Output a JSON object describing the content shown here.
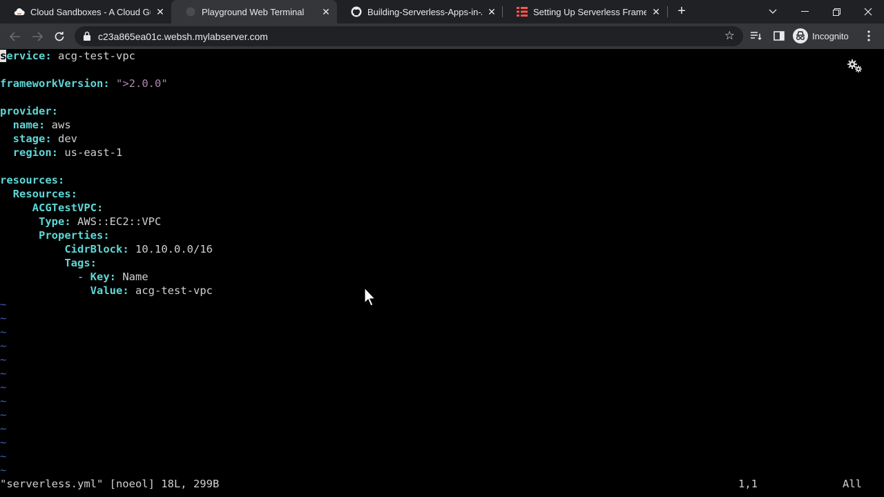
{
  "browser": {
    "tabs": [
      {
        "title": "Cloud Sandboxes - A Cloud Guru",
        "icon": "cloud-icon"
      },
      {
        "title": "Playground Web Terminal",
        "icon": "terminal-icon"
      },
      {
        "title": "Building-Serverless-Apps-in-AWS",
        "icon": "github-icon"
      },
      {
        "title": "Setting Up Serverless Framework",
        "icon": "serverless-icon"
      }
    ],
    "active_tab": 1,
    "url": "c23a865ea01c.websh.mylabserver.com",
    "profile_label": "Incognito"
  },
  "terminal": {
    "lines": [
      {
        "indent": "",
        "key": "service",
        "value": " acg-test-vpc"
      },
      {
        "indent": "",
        "key": "",
        "value": ""
      },
      {
        "indent": "",
        "key": "frameworkVersion",
        "string": "\">2.0.0\""
      },
      {
        "indent": "",
        "key": "",
        "value": ""
      },
      {
        "indent": "",
        "key": "provider",
        "value": ""
      },
      {
        "indent": "  ",
        "key": "name",
        "value": " aws"
      },
      {
        "indent": "  ",
        "key": "stage",
        "value": " dev"
      },
      {
        "indent": "  ",
        "key": "region",
        "value": " us-east-1"
      },
      {
        "indent": "",
        "key": "",
        "value": ""
      },
      {
        "indent": "",
        "key": "resources",
        "value": ""
      },
      {
        "indent": "  ",
        "key": "Resources",
        "value": ""
      },
      {
        "indent": "     ",
        "key": "ACGTestVPC",
        "value": ""
      },
      {
        "indent": "      ",
        "key": "Type",
        "value": " AWS::EC2::VPC"
      },
      {
        "indent": "      ",
        "key": "Properties",
        "value": ""
      },
      {
        "indent": "          ",
        "key": "CidrBlock",
        "value": " 10.10.0.0/16"
      },
      {
        "indent": "          ",
        "key": "Tags",
        "value": ""
      },
      {
        "indent": "            - ",
        "key": "Key",
        "value": " Name"
      },
      {
        "indent": "              ",
        "key": "Value",
        "value": " acg-test-vpc"
      }
    ],
    "tilde_count": 13,
    "status_file": "\"serverless.yml\" [noeol] 18L, 299B",
    "status_pos": "1,1",
    "status_scroll": "All"
  },
  "colors": {
    "key": "#5fd7d7",
    "string": "#af87af",
    "tilde": "#4060c0",
    "tabstrip": "#202124",
    "toolbar": "#35363a"
  }
}
